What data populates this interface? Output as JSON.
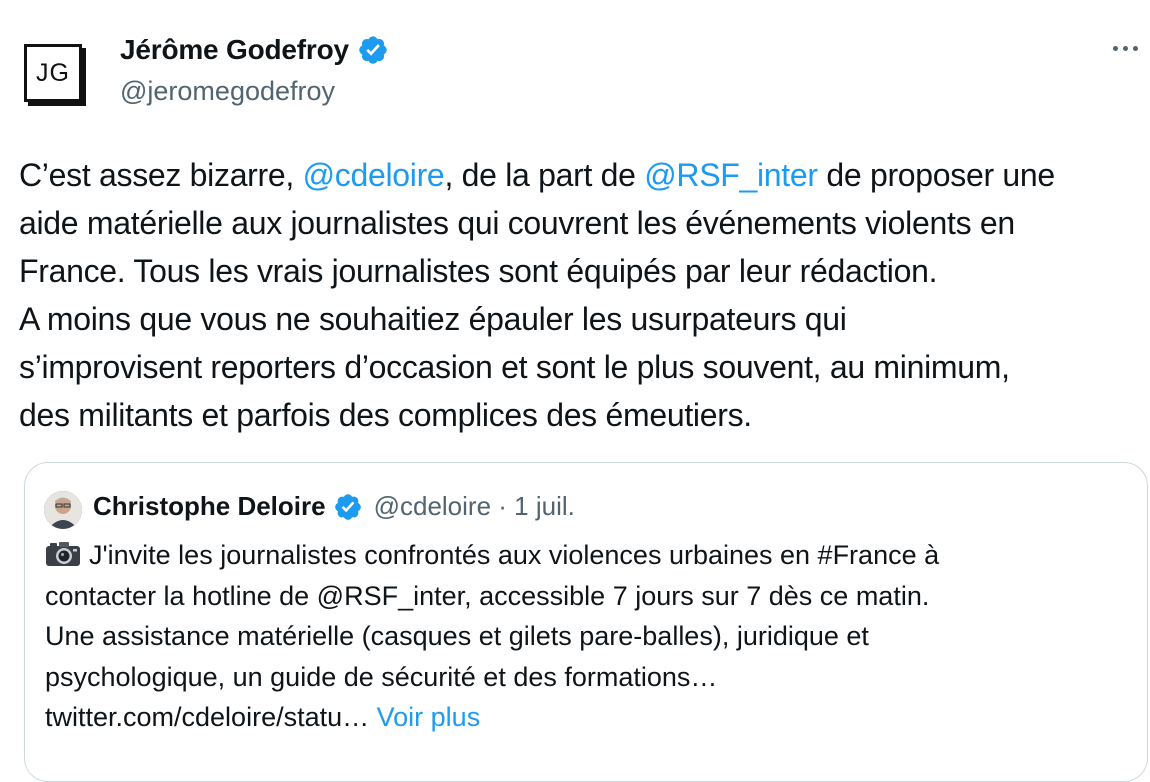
{
  "author": {
    "avatar_initials": "JG",
    "display_name": "Jérôme Godefroy",
    "handle": "@jeromegodefroy",
    "verified": true
  },
  "tweet": {
    "lines": [
      {
        "parts": [
          {
            "text": "C’est assez bizarre, ",
            "type": "text"
          },
          {
            "text": "@cdeloire",
            "type": "mention"
          },
          {
            "text": ", de la part de ",
            "type": "text"
          },
          {
            "text": "@RSF_inter",
            "type": "mention"
          },
          {
            "text": " de proposer une",
            "type": "text"
          }
        ]
      },
      {
        "text": "aide matérielle aux journalistes qui couvrent les événements violents en"
      },
      {
        "text": "France. Tous les vrais journalistes sont équipés par leur rédaction."
      },
      {
        "text": "A moins que vous ne souhaitiez épauler les usurpateurs qui"
      },
      {
        "text": "s’improvisent reporters d’occasion et sont le plus souvent, au minimum,"
      },
      {
        "text": "des militants et parfois des complices des émeutiers."
      }
    ]
  },
  "quoted_tweet": {
    "display_name": "Christophe Deloire",
    "handle_date": "@cdeloire · 1 juil.",
    "verified": true,
    "lines": [
      {
        "text": "J'invite les journalistes confrontés aux violences urbaines en #France à"
      },
      {
        "text": "contacter la hotline de @RSF_inter, accessible 7 jours sur 7 dès ce matin."
      },
      {
        "text": "Une assistance matérielle (casques et gilets pare-balles), juridique et"
      },
      {
        "text": "psychologique, un guide de sécurité et des formations…"
      },
      {
        "text": "twitter.com/cdeloire/statu…"
      }
    ],
    "voir_plus": "Voir plus"
  },
  "icons": {
    "verified": "verified-badge-icon",
    "more": "more-options-icon",
    "camera": "camera-emoji-icon"
  },
  "colors": {
    "accent": "#1d9bf0",
    "text": "#0f1419",
    "secondary": "#536471",
    "border": "#cfd9de"
  }
}
